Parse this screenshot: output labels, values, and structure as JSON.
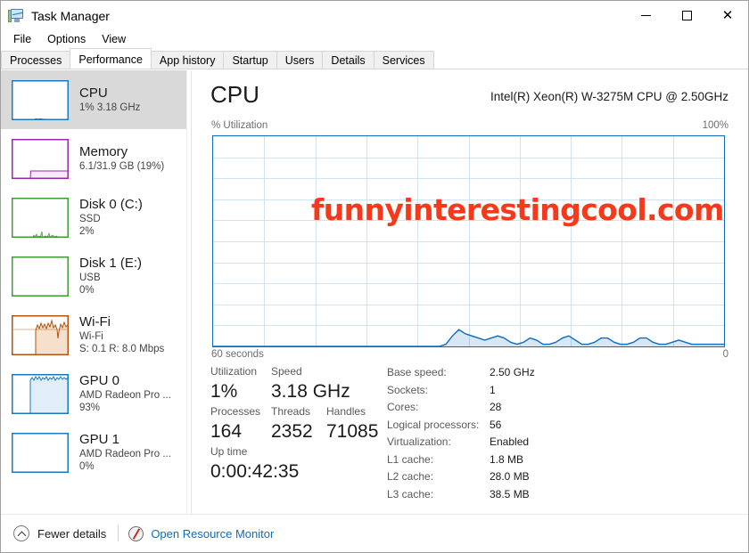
{
  "window": {
    "title": "Task Manager",
    "icon": "task-manager-icon",
    "minimize": "—",
    "maximize": "□",
    "close": "✕"
  },
  "menu": [
    {
      "label": "File"
    },
    {
      "label": "Options"
    },
    {
      "label": "View"
    }
  ],
  "tabs": [
    {
      "label": "Processes",
      "active": false
    },
    {
      "label": "Performance",
      "active": true
    },
    {
      "label": "App history",
      "active": false
    },
    {
      "label": "Startup",
      "active": false
    },
    {
      "label": "Users",
      "active": false
    },
    {
      "label": "Details",
      "active": false
    },
    {
      "label": "Services",
      "active": false
    }
  ],
  "sidebar": {
    "items": [
      {
        "name": "CPU",
        "line2": "1%  3.18 GHz",
        "line3": "",
        "selected": true,
        "color": "#1a7ac0",
        "fill": "rgba(26,122,192,0.12)"
      },
      {
        "name": "Memory",
        "line2": "6.1/31.9 GB (19%)",
        "line3": "",
        "selected": false,
        "color": "#9b27b0",
        "fill": "rgba(155,39,176,0.10)"
      },
      {
        "name": "Disk 0 (C:)",
        "line2": "SSD",
        "line3": "2%",
        "selected": false,
        "color": "#3f9c35",
        "fill": "rgba(63,156,53,0.15)"
      },
      {
        "name": "Disk 1 (E:)",
        "line2": "USB",
        "line3": "0%",
        "selected": false,
        "color": "#3f9c35",
        "fill": "rgba(63,156,53,0.15)"
      },
      {
        "name": "Wi-Fi",
        "line2": "Wi-Fi",
        "line3": "S: 0.1 R: 8.0 Mbps",
        "selected": false,
        "color": "#b5500f",
        "fill": "rgba(224,140,70,0.22)"
      },
      {
        "name": "GPU 0",
        "line2": "AMD Radeon Pro ...",
        "line3": "93%",
        "selected": false,
        "color": "#1a7ac0",
        "fill": "rgba(26,122,192,0.13)"
      },
      {
        "name": "GPU 1",
        "line2": "AMD Radeon Pro ...",
        "line3": "0%",
        "selected": false,
        "color": "#1a7ac0",
        "fill": "rgba(26,122,192,0.13)"
      }
    ]
  },
  "main": {
    "title": "CPU",
    "cpu_name": "Intel(R) Xeon(R) W-3275M CPU @ 2.50GHz",
    "y_axis_label": "% Utilization",
    "y_axis_max": "100%",
    "x_axis_left": "60 seconds",
    "x_axis_right": "0",
    "watermark": "funnyinterestingcool.com",
    "watermark_color": "#f6391b",
    "graph_line_color": "#0f6cbd",
    "graph_grid_color": "#cfe3f2"
  },
  "stats": {
    "utilization_label": "Utilization",
    "utilization_value": "1%",
    "speed_label": "Speed",
    "speed_value": "3.18 GHz",
    "processes_label": "Processes",
    "processes_value": "164",
    "threads_label": "Threads",
    "threads_value": "2352",
    "handles_label": "Handles",
    "handles_value": "71085",
    "uptime_label": "Up time",
    "uptime_value": "0:00:42:35"
  },
  "details": [
    {
      "key": "Base speed:",
      "value": "2.50 GHz"
    },
    {
      "key": "Sockets:",
      "value": "1"
    },
    {
      "key": "Cores:",
      "value": "28"
    },
    {
      "key": "Logical processors:",
      "value": "56"
    },
    {
      "key": "Virtualization:",
      "value": "Enabled"
    },
    {
      "key": "L1 cache:",
      "value": "1.8 MB"
    },
    {
      "key": "L2 cache:",
      "value": "28.0 MB"
    },
    {
      "key": "L3 cache:",
      "value": "38.5 MB"
    }
  ],
  "statusbar": {
    "fewer_details": "Fewer details",
    "open_resource_monitor": "Open Resource Monitor",
    "link_color": "#0d6ebd"
  },
  "chart_data": {
    "type": "area",
    "title": "CPU % Utilization",
    "xlabel": "60 seconds",
    "ylabel": "% Utilization",
    "ylim": [
      0,
      100
    ],
    "xlim": [
      60,
      0
    ],
    "grid": true,
    "grid_cols": 10,
    "grid_rows": 10,
    "series": [
      {
        "name": "CPU Utilization",
        "color": "#0f6cbd",
        "values": [
          0,
          0,
          0,
          0,
          0,
          0,
          0,
          0,
          0,
          0,
          0,
          0,
          0,
          0,
          0,
          0,
          0,
          0,
          0,
          0,
          0,
          0,
          0,
          0,
          0,
          0,
          0,
          0,
          0,
          0,
          0,
          0,
          0,
          0,
          0,
          0,
          1,
          5,
          8,
          6,
          5,
          4,
          3,
          4,
          5,
          4,
          2,
          1,
          2,
          4,
          3,
          1,
          1,
          2,
          4,
          5,
          3,
          1,
          1,
          2,
          4,
          4,
          2,
          1,
          1,
          2,
          4,
          4,
          2,
          1,
          1,
          2,
          3,
          2,
          1,
          1,
          1,
          1,
          1,
          1
        ]
      }
    ]
  }
}
